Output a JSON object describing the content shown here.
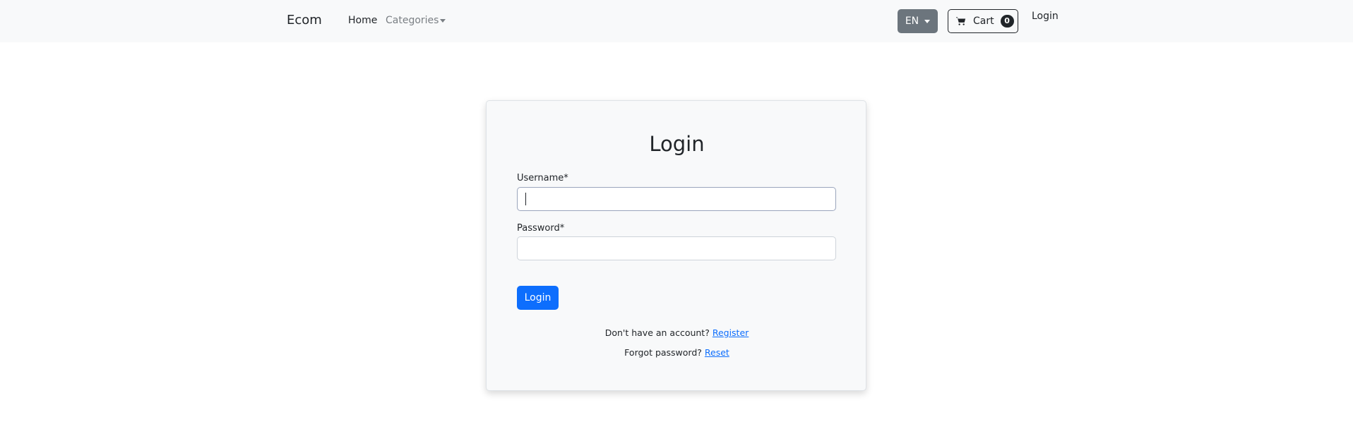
{
  "navbar": {
    "brand": "Ecom",
    "home": "Home",
    "categories": "Categories",
    "language": "EN",
    "cart_label": "Cart",
    "cart_count": "0",
    "login": "Login"
  },
  "form": {
    "title": "Login",
    "username_label": "Username*",
    "username_value": "",
    "password_label": "Password*",
    "password_value": "",
    "submit": "Login",
    "register_prompt": "Don't have an account?",
    "register_link": "Register",
    "reset_prompt": "Forgot password?",
    "reset_link": "Reset"
  },
  "colors": {
    "primary": "#0d6efd",
    "secondary": "#6c757d",
    "navbar_bg": "#f8f9fa"
  },
  "icons": {
    "cart": "cart-icon",
    "caret": "chevron-down-icon"
  }
}
